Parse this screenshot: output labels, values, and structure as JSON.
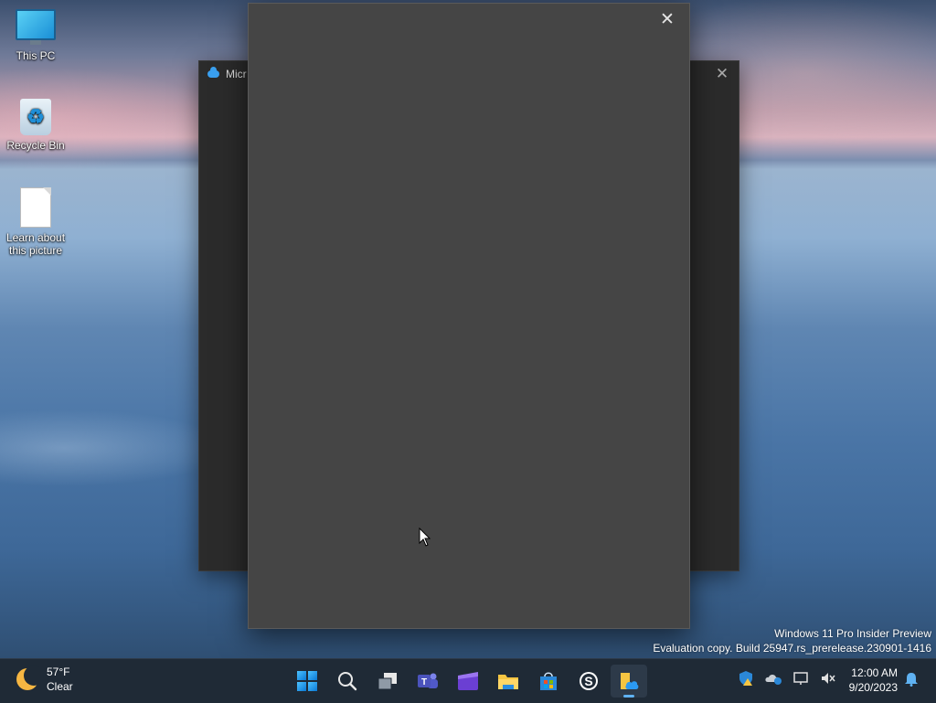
{
  "desktop": {
    "icons": [
      {
        "label": "This PC",
        "icon": "computer-icon"
      },
      {
        "label": "Recycle Bin",
        "icon": "recycle-bin-icon"
      },
      {
        "label": "Learn about this picture",
        "icon": "document-icon"
      }
    ]
  },
  "back_window": {
    "title": "Micr",
    "app_icon": "onedrive-cloud-icon",
    "close_glyph": "✕"
  },
  "front_window": {
    "close_glyph": "✕"
  },
  "watermark": {
    "line1": "Windows 11 Pro Insider Preview",
    "line2": "Evaluation copy. Build 25947.rs_prerelease.230901-1416"
  },
  "taskbar": {
    "weather": {
      "temp": "57°F",
      "condition": "Clear",
      "icon": "moon-icon"
    },
    "apps": [
      {
        "name": "Start",
        "icon": "windows-logo-icon"
      },
      {
        "name": "Search",
        "icon": "search-icon"
      },
      {
        "name": "Task View",
        "icon": "task-view-icon"
      },
      {
        "name": "Teams",
        "icon": "teams-icon"
      },
      {
        "name": "Clipchamp",
        "icon": "clipchamp-icon"
      },
      {
        "name": "File Explorer",
        "icon": "folder-icon"
      },
      {
        "name": "Microsoft Store",
        "icon": "store-icon"
      },
      {
        "name": "Skype",
        "icon": "skype-icon"
      },
      {
        "name": "OneDrive",
        "icon": "onedrive-icon",
        "active": true
      }
    ],
    "tray": [
      "security-warning-icon",
      "onedrive-info-icon",
      "network-icon",
      "volume-muted-icon"
    ],
    "clock": {
      "time": "12:00 AM",
      "date": "9/20/2023"
    },
    "notification_icon": "bell-icon"
  },
  "colors": {
    "accent": "#5fb2f2",
    "taskbar": "#1f2a36",
    "front_window": "#454545",
    "back_window": "#2b2b2b"
  }
}
